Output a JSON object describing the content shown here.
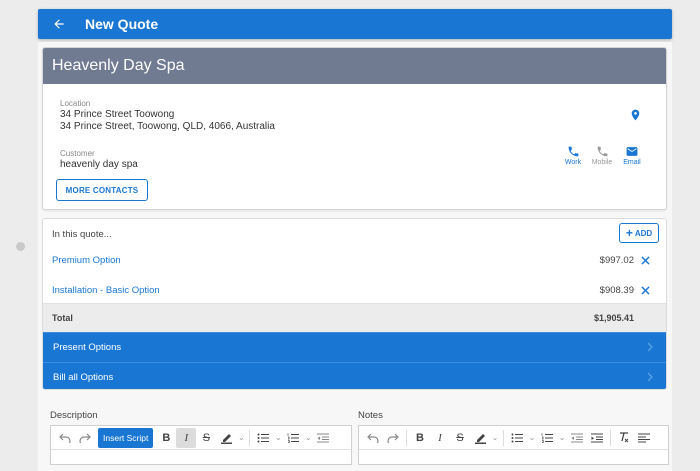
{
  "header": {
    "title": "New Quote",
    "back_icon": "arrow-left-icon"
  },
  "card": {
    "title": "Heavenly Day Spa",
    "location_label": "Location",
    "location_line1": "34 Prince Street Toowong",
    "location_line2": "34 Prince Street, Toowong, QLD, 4066, Australia",
    "customer_label": "Customer",
    "customer_value": "heavenly day spa",
    "contacts": [
      {
        "label": "Work",
        "icon": "phone-icon",
        "enabled": true
      },
      {
        "label": "Mobile",
        "icon": "phone-icon",
        "enabled": false
      },
      {
        "label": "Email",
        "icon": "email-icon",
        "enabled": true
      }
    ],
    "more_contacts": "MORE CONTACTS"
  },
  "quote": {
    "intro": "In this quote...",
    "add_label": "ADD",
    "items": [
      {
        "name": "Premium Option",
        "price": "$997.02"
      },
      {
        "name": "Installation - Basic Option",
        "price": "$908.39"
      }
    ],
    "total_label": "Total",
    "total_value": "$1,905.41",
    "actions": [
      "Present Options",
      "Bill all Options"
    ]
  },
  "description": {
    "label": "Description",
    "insert_script": "Insert Script"
  },
  "notes": {
    "label": "Notes"
  },
  "colors": {
    "primary": "#1976d2",
    "card_header": "#707a91"
  }
}
